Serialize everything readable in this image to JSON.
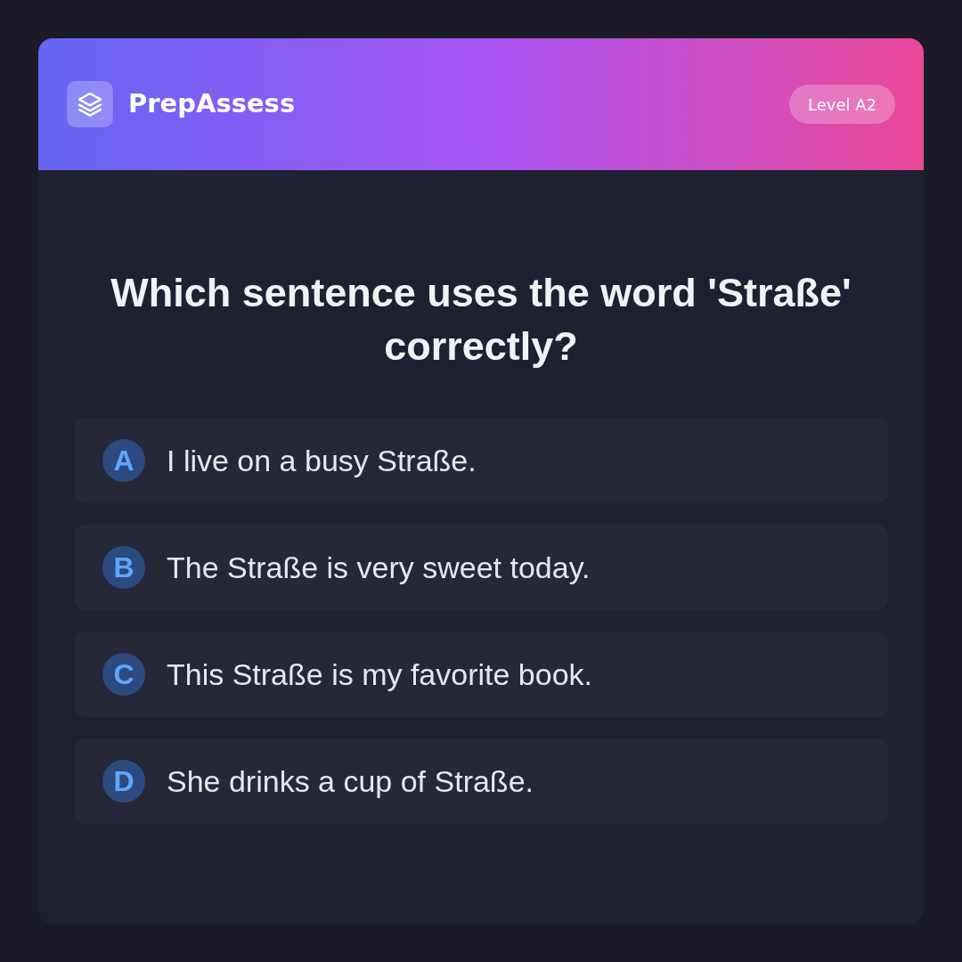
{
  "header": {
    "brand": "PrepAssess",
    "level_badge": "Level A2"
  },
  "question": {
    "text": "Which sentence uses the word 'Straße' correctly?"
  },
  "options": [
    {
      "letter": "A",
      "text": "I live on a busy Straße.",
      "selected": false
    },
    {
      "letter": "B",
      "text": "The Straße is very sweet today.",
      "selected": false
    },
    {
      "letter": "C",
      "text": "This Straße is my favorite book.",
      "selected": false
    },
    {
      "letter": "D",
      "text": "She drinks a cup of Straße.",
      "selected": false
    }
  ]
}
